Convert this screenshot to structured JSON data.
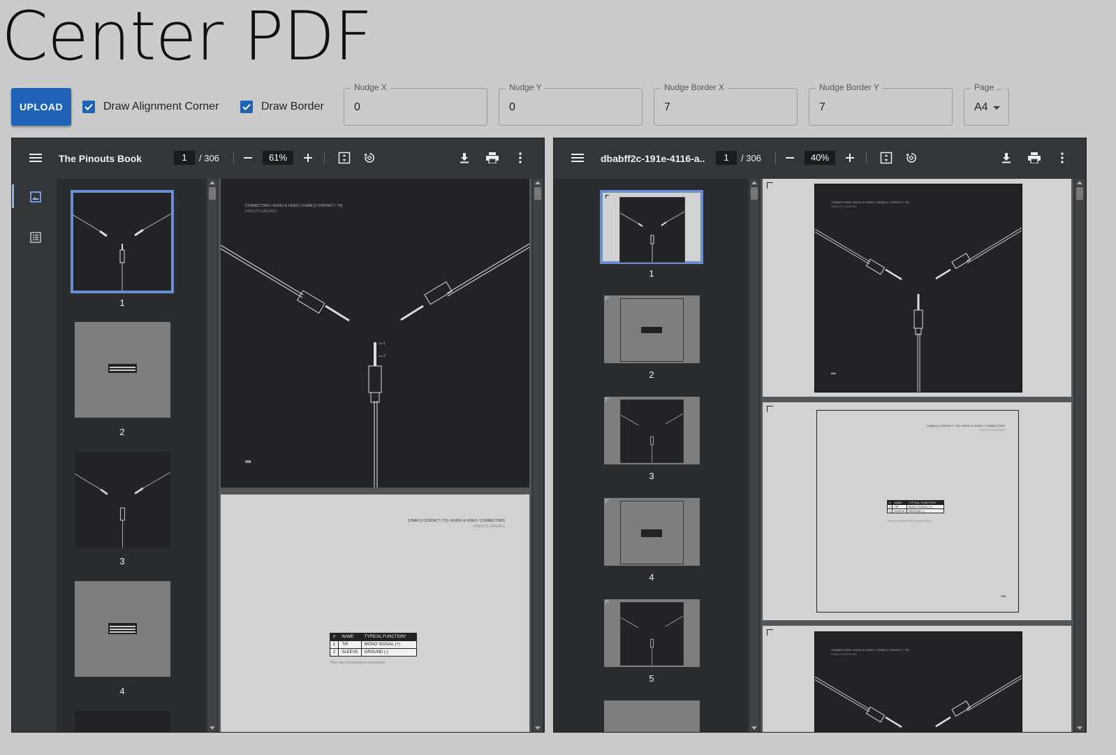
{
  "page": {
    "title": "Center PDF"
  },
  "controls": {
    "upload_label": "UPLOAD",
    "draw_alignment_corner": {
      "label": "Draw Alignment Corner",
      "checked": true
    },
    "draw_border": {
      "label": "Draw Border",
      "checked": true
    },
    "nudge_x": {
      "label": "Nudge X",
      "value": "0"
    },
    "nudge_y": {
      "label": "Nudge Y",
      "value": "0"
    },
    "nudge_border_x": {
      "label": "Nudge Border X",
      "value": "7"
    },
    "nudge_border_y": {
      "label": "Nudge Border Y",
      "value": "7"
    },
    "page_size": {
      "label": "Page ...",
      "value": "A4"
    }
  },
  "left_viewer": {
    "title": "The Pinouts Book",
    "page_current": "1",
    "page_total": "/ 306",
    "zoom": "61%",
    "thumbnails": [
      "1",
      "2",
      "3",
      "4"
    ]
  },
  "right_viewer": {
    "title": "dbabff2c-191e-4116-a...",
    "page_current": "1",
    "page_total": "/ 306",
    "zoom": "40%",
    "thumbnails": [
      "1",
      "2",
      "3",
      "4",
      "5"
    ]
  },
  "pdf_content": {
    "page1_header": "CONNECTORS  /  AUDIO & VIDEO  /  3.5MM (2 CONTACT / TS)",
    "page1_sub": "PINOUTS.ORG/A01",
    "page1_number": "008",
    "pin_labels": [
      "1",
      "2"
    ],
    "page2_header": "3.5MM (2 CONTACT / TS)  /  AUDIO & VIDEO  /  CONNECTORS",
    "page2_sub": "PINOUTS.ORG/A01",
    "table_headers": [
      "#",
      "NAME",
      "TYPICAL FUNCTION*"
    ],
    "table_rows": [
      [
        "1",
        "TIP",
        "MONO SIGNAL (+)"
      ],
      [
        "2",
        "SLEEVE",
        "GROUND (-)"
      ]
    ],
    "footnote": "*May vary depending on application",
    "page2_number": "009"
  },
  "colors": {
    "accent": "#1e63b5",
    "toolbar": "#323639",
    "sidebar": "#2a2d2f",
    "selected_thumb": "#8ab4f8",
    "page_dark": "#222326",
    "page_light": "#d2d2d2"
  }
}
